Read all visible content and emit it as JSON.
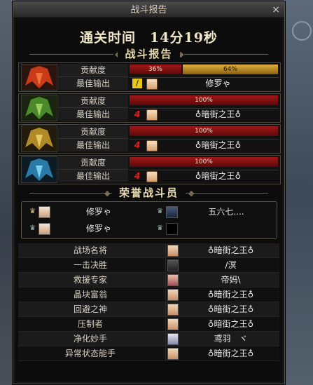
{
  "window": {
    "title": "战斗报告",
    "close_label": "×"
  },
  "clear_time": "通关时间　14分19秒",
  "sections": {
    "battle_report": "战斗报告",
    "honor": "荣誉战斗员"
  },
  "labels": {
    "contribution": "贡献度",
    "best_output": "最佳输出"
  },
  "players": [
    {
      "avatar_color": "#c83a18",
      "bars": [
        {
          "text": "36%",
          "value": 36,
          "style": "red"
        },
        {
          "text": "64%",
          "value": 64,
          "style": "gold"
        }
      ],
      "weapon_icon": "sword-icon",
      "weapon_glyph": "/",
      "best_name": "修罗ゃ"
    },
    {
      "avatar_color": "#4b8a2a",
      "bars": [
        {
          "text": "100%",
          "value": 100,
          "style": "red"
        }
      ],
      "weapon_icon": "claw-icon",
      "weapon_glyph": "4",
      "best_name": "♁暗街之王♁"
    },
    {
      "avatar_color": "#b08a28",
      "bars": [
        {
          "text": "100%",
          "value": 100,
          "style": "red"
        }
      ],
      "weapon_icon": "claw-icon",
      "weapon_glyph": "4",
      "best_name": "♁暗街之王♁"
    },
    {
      "avatar_color": "#2a7aa8",
      "bars": [
        {
          "text": "100%",
          "value": 100,
          "style": "red"
        }
      ],
      "weapon_icon": "claw-icon",
      "weapon_glyph": "4",
      "best_name": "♁暗街之王♁"
    }
  ],
  "honor_members": [
    {
      "name": "修罗ゃ",
      "crown": "gold"
    },
    {
      "name": "五六七....",
      "crown": "silver"
    },
    {
      "name": "修罗ゃ",
      "crown": "silver"
    },
    {
      "name": "",
      "crown": "silver"
    }
  ],
  "titles": [
    {
      "title": "战场名将",
      "name": "♁暗街之王♁"
    },
    {
      "title": "一击决胜",
      "name": "/溟"
    },
    {
      "title": "救援专家",
      "name": "帝妈\\"
    },
    {
      "title": "晶块富翁",
      "name": "♁暗街之王♁"
    },
    {
      "title": "回避之神",
      "name": "♁暗街之王♁"
    },
    {
      "title": "压制者",
      "name": "♁暗街之王♁"
    },
    {
      "title": "净化妙手",
      "name": "鸢羽　ヾ"
    },
    {
      "title": "异常状态能手",
      "name": "♁暗街之王♁"
    }
  ]
}
